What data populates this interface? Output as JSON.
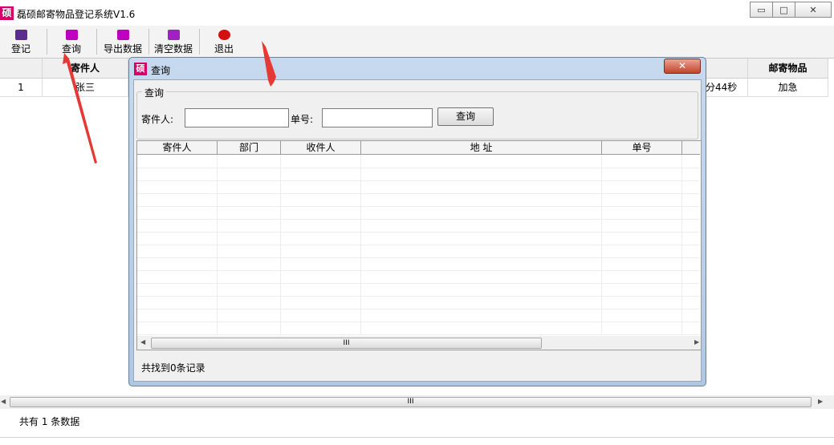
{
  "window": {
    "icon_text": "硕",
    "title": "磊硕邮寄物品登记系统V1.6",
    "controls": {
      "minimize": "▭",
      "maximize": "□",
      "close": "✕"
    }
  },
  "toolbar": {
    "items": [
      {
        "label": "登记",
        "icon": "register-icon",
        "color": "#5b2d8e"
      },
      {
        "label": "查询",
        "icon": "query-icon",
        "color": "#c000c0"
      },
      {
        "label": "导出数据",
        "icon": "export-icon",
        "color": "#c000c0"
      },
      {
        "label": "清空数据",
        "icon": "clear-icon",
        "color": "#a020c0"
      },
      {
        "label": "退出",
        "icon": "exit-icon",
        "color": "#d41111"
      }
    ]
  },
  "main_table": {
    "headers": {
      "sender": "寄件人",
      "item": "邮寄物品"
    },
    "rows": [
      {
        "index": "1",
        "sender": "张三",
        "time_fragment": "分44秒",
        "item": "加急"
      }
    ]
  },
  "dialog": {
    "icon_text": "硕",
    "title": "查询",
    "close_label": "✕",
    "group_label": "查询",
    "sender_label": "寄件人:",
    "sender_value": "",
    "number_label": "单号:",
    "number_value": "",
    "query_button": "查询",
    "columns": [
      "寄件人",
      "部门",
      "收件人",
      "地 址",
      "单号"
    ],
    "scroll_grip": "III",
    "found_text": "共找到0条记录"
  },
  "main_scroll_grip": "III",
  "status": {
    "text": "共有 1 条数据"
  },
  "colors": {
    "annotation_arrow": "#e53935",
    "dialog_frame": "#aec8e4",
    "brand": "#d6006a"
  }
}
